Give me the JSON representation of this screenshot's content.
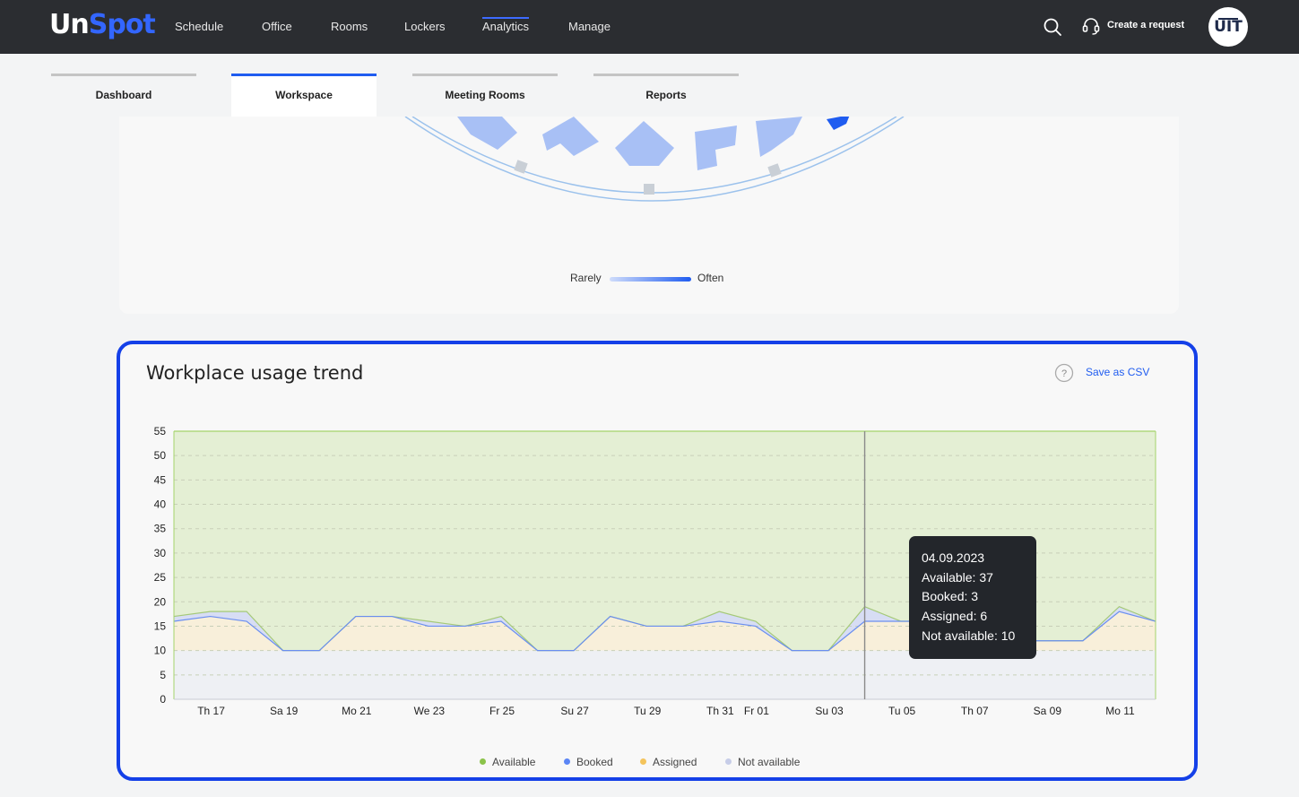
{
  "app": {
    "logo_part1": "Un",
    "logo_part2": "Spot",
    "nav": [
      "Schedule",
      "Office",
      "Rooms",
      "Lockers",
      "Analytics",
      "Manage"
    ],
    "active_nav": "Analytics",
    "create_request": "Create a request",
    "avatar_text": "UIT"
  },
  "subtabs": [
    "Dashboard",
    "Workspace",
    "Meeting Rooms",
    "Reports"
  ],
  "active_subtab": "Workspace",
  "heatmap_legend": {
    "low": "Rarely",
    "high": "Often"
  },
  "trend_card": {
    "title": "Workplace usage trend",
    "save_label": "Save as CSV"
  },
  "tooltip": {
    "date": "04.09.2023",
    "available": "Available: 37",
    "booked": "Booked: 3",
    "assigned": "Assigned: 6",
    "not_available": "Not available: 10"
  },
  "colors": {
    "available": "#8bc34a",
    "booked": "#5b85f5",
    "assigned": "#f4c45c",
    "not_available": "#c7cde8",
    "accent": "#1f5cf0"
  },
  "chart_data": {
    "type": "area",
    "stacked": true,
    "ylim": [
      0,
      55
    ],
    "yticks": [
      0,
      5,
      10,
      15,
      20,
      25,
      30,
      35,
      40,
      45,
      50,
      55
    ],
    "x_tick_labels": [
      "Th 17",
      "Sa 19",
      "Mo 21",
      "We 23",
      "Fr 25",
      "Su 27",
      "Tu 29",
      "Th 31",
      "Fr 01",
      "Su 03",
      "Tu 05",
      "Th 07",
      "Sa 09",
      "Mo 11"
    ],
    "x_tick_index": [
      1,
      3,
      5,
      7,
      9,
      11,
      13,
      15,
      16,
      18,
      20,
      22,
      24,
      26
    ],
    "grid": true,
    "legend_position": "bottom",
    "hover_index": 19,
    "series": [
      {
        "name": "Not available",
        "values": [
          10,
          10,
          10,
          10,
          10,
          10,
          10,
          10,
          10,
          10,
          10,
          10,
          10,
          10,
          10,
          10,
          10,
          10,
          10,
          10,
          10,
          10,
          10,
          10,
          10,
          10,
          10,
          10
        ]
      },
      {
        "name": "Assigned",
        "values": [
          6,
          7,
          6,
          0,
          0,
          7,
          7,
          5,
          5,
          6,
          0,
          0,
          7,
          5,
          5,
          6,
          5,
          0,
          0,
          6,
          6,
          6,
          6,
          2,
          2,
          2,
          8,
          6
        ]
      },
      {
        "name": "Booked",
        "values": [
          0,
          0,
          0,
          0,
          0,
          0,
          0,
          0,
          0,
          0,
          0,
          0,
          0,
          0,
          0,
          0,
          0,
          0,
          0,
          0,
          0,
          0,
          0,
          0,
          0,
          0,
          0,
          0
        ]
      },
      {
        "name": "Available",
        "values": [
          37,
          37,
          37,
          37,
          37,
          37,
          37,
          37,
          37,
          37,
          37,
          37,
          37,
          37,
          37,
          37,
          37,
          37,
          37,
          37,
          37,
          37,
          37,
          37,
          37,
          37,
          37,
          37
        ]
      }
    ],
    "booked_extra": [
      1,
      1,
      2,
      0,
      0,
      0,
      0,
      1,
      0,
      1,
      0,
      0,
      0,
      0,
      0,
      2,
      1,
      0,
      0,
      3,
      0,
      0,
      0,
      0,
      0,
      0,
      1,
      0
    ]
  },
  "legend": [
    "Available",
    "Booked",
    "Assigned",
    "Not available"
  ]
}
